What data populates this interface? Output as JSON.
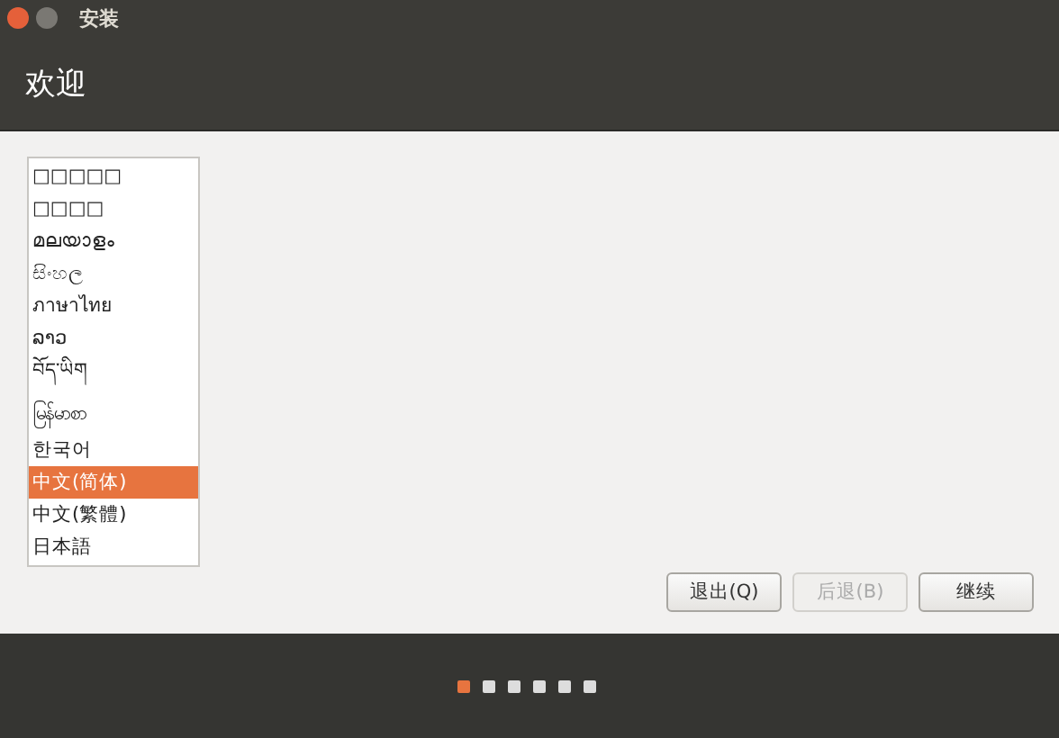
{
  "window": {
    "title": "安装"
  },
  "header": {
    "title": "欢迎"
  },
  "languages": [
    {
      "label": "□□□□□",
      "selected": false
    },
    {
      "label": "□□□□",
      "selected": false
    },
    {
      "label": "മലയാളം",
      "selected": false
    },
    {
      "label": "සිංහල",
      "selected": false
    },
    {
      "label": "ภาษาไทย",
      "selected": false
    },
    {
      "label": "ລາວ",
      "selected": false
    },
    {
      "label": "བོད་ཡིག",
      "selected": false
    },
    {
      "label": "မြန်မာစာ",
      "selected": false
    },
    {
      "label": "한국어",
      "selected": false
    },
    {
      "label": "中文(简体)",
      "selected": true
    },
    {
      "label": "中文(繁體)",
      "selected": false
    },
    {
      "label": "日本語",
      "selected": false
    }
  ],
  "buttons": [
    {
      "label": "退出(Q)",
      "disabled": false
    },
    {
      "label": "后退(B)",
      "disabled": true
    },
    {
      "label": "继续",
      "disabled": false
    }
  ],
  "steps": [
    {
      "selected": true
    },
    {
      "selected": false
    },
    {
      "selected": false
    },
    {
      "selected": false
    },
    {
      "selected": false
    },
    {
      "selected": false
    }
  ]
}
